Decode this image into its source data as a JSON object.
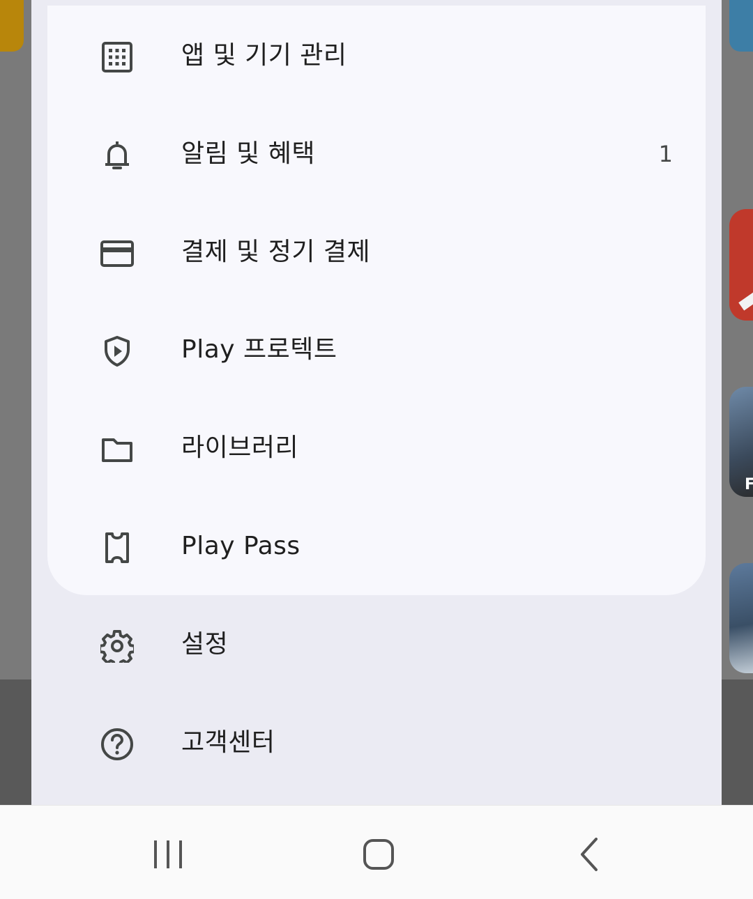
{
  "menu": {
    "items": [
      {
        "label": "앱 및 기기 관리",
        "icon": "apps-grid-icon"
      },
      {
        "label": "알림 및 혜택",
        "icon": "bell-icon",
        "count": "1"
      },
      {
        "label": "결제 및 정기 결제",
        "icon": "credit-card-icon"
      },
      {
        "label": "Play 프로텍트",
        "icon": "shield-play-icon"
      },
      {
        "label": "라이브러리",
        "icon": "folder-icon"
      },
      {
        "label": "Play Pass",
        "icon": "ticket-icon"
      }
    ],
    "footer_items": [
      {
        "label": "설정",
        "icon": "gear-icon"
      },
      {
        "label": "고객센터",
        "icon": "help-circle-icon"
      }
    ]
  },
  "system_nav": {
    "buttons": [
      "recent-apps-icon",
      "home-icon",
      "back-icon"
    ]
  },
  "colors": {
    "panel_bg": "#ebebf3",
    "card_bg": "#f8f8fd",
    "text": "#1f1f1f",
    "icon": "#444746"
  }
}
